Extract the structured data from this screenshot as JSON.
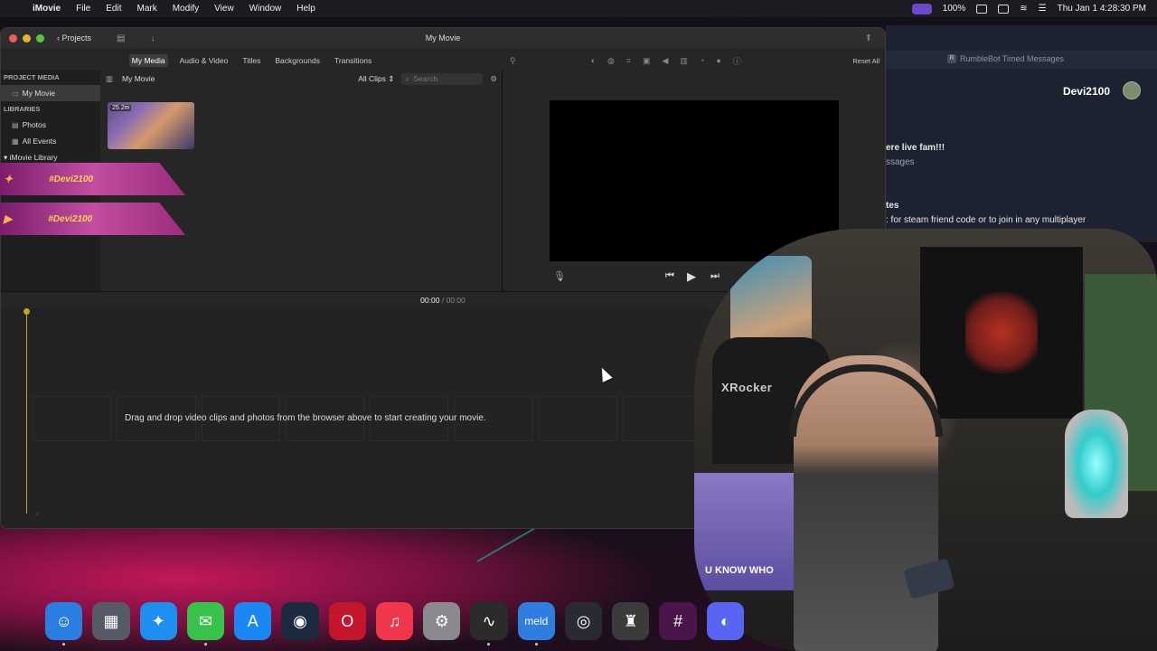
{
  "menubar": {
    "app_name": "iMovie",
    "items": [
      "File",
      "Edit",
      "Mark",
      "Modify",
      "View",
      "Window",
      "Help"
    ],
    "battery": "100%",
    "datetime": "Thu Jan 1  4:28:30 PM"
  },
  "window": {
    "title": "My Movie",
    "projects_label": "Projects",
    "tabs": [
      "My Media",
      "Audio & Video",
      "Titles",
      "Backgrounds",
      "Transitions"
    ],
    "active_tab": "My Media",
    "reset_all": "Reset All"
  },
  "sidebar": {
    "project_media_heading": "PROJECT MEDIA",
    "project_item": "My Movie",
    "libraries_heading": "LIBRARIES",
    "photos": "Photos",
    "all_events": "All Events",
    "library": "iMovie Library"
  },
  "media_browser": {
    "title": "My Movie",
    "filter": "All Clips",
    "search_placeholder": "Search",
    "clip_duration": "25.2m"
  },
  "banners": [
    {
      "handle": "#Devi2100"
    },
    {
      "handle": "#Devi2100"
    }
  ],
  "timeline": {
    "current": "00:00",
    "separator": "/",
    "total": "00:00",
    "empty_message": "Drag and drop video clips and photos from the browser above to start creating your movie."
  },
  "background_browser": {
    "tab_title": "RumbleBot Timed Messages",
    "tab_favicon": "R",
    "username": "Devi2100",
    "line1": "ere live fam!!!",
    "line2": "ssages",
    "line3": "tes",
    "line4": ": for steam friend code or to join in any multiplayer"
  },
  "webcam": {
    "chair_brand": "XRocker",
    "mug_text": "U KNOW WHO"
  },
  "dock": [
    {
      "name": "finder",
      "glyph": "☺",
      "color": "#2a7de1"
    },
    {
      "name": "launchpad",
      "glyph": "▦",
      "color": "#555a66"
    },
    {
      "name": "safari",
      "glyph": "✦",
      "color": "#1e8ef0"
    },
    {
      "name": "messages",
      "glyph": "✉",
      "color": "#36c24b"
    },
    {
      "name": "app-store",
      "glyph": "A",
      "color": "#1a87f2"
    },
    {
      "name": "steam",
      "glyph": "◉",
      "color": "#1b2a3f"
    },
    {
      "name": "opera",
      "glyph": "O",
      "color": "#c4152c"
    },
    {
      "name": "music",
      "glyph": "♫",
      "color": "#f0364a"
    },
    {
      "name": "system-settings",
      "glyph": "⚙",
      "color": "#8a8a8e"
    },
    {
      "name": "activity-monitor",
      "glyph": "∿",
      "color": "#2b2b2b"
    },
    {
      "name": "meld",
      "glyph": "meld",
      "color": "#2f7de0"
    },
    {
      "name": "obs",
      "glyph": "◎",
      "color": "#2a2a33"
    },
    {
      "name": "rumblebot",
      "glyph": "♜",
      "color": "#3b3b3b"
    },
    {
      "name": "slack",
      "glyph": "#",
      "color": "#4a154b"
    },
    {
      "name": "discord",
      "glyph": "◐",
      "color": "#5865f2"
    }
  ]
}
